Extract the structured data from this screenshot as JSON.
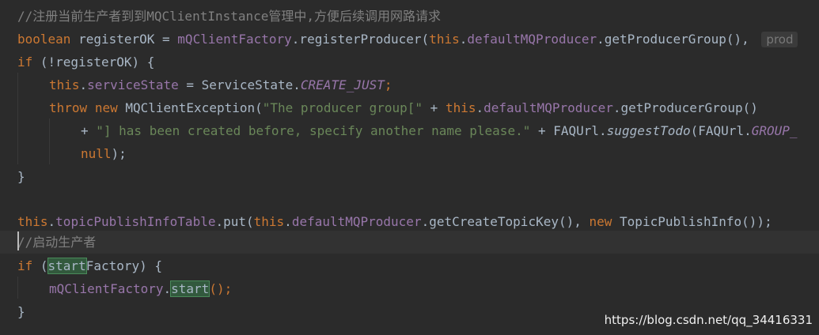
{
  "code": {
    "l1_comment": "//注册当前生产者到到MQClientInstance管理中,方便后续调用网路请求",
    "l2_kw": "boolean",
    "l2_var": " registerOK = ",
    "l2_fld": "mQClientFactory",
    "l2_call": ".registerProducer(",
    "l2_this": "this",
    "l2_dot": ".",
    "l2_fld2": "defaultMQProducer",
    "l2_tail": ".getProducerGroup(), ",
    "l2_hint": "prod",
    "l3_kw": "if",
    "l3_rest": " (!registerOK) {",
    "l4_this": "this",
    "l4_dot": ".",
    "l4_fld": "serviceState",
    "l4_mid": " = ServiceState.",
    "l4_const": "CREATE_JUST",
    "l4_semi": ";",
    "l5_kw1": "throw",
    "l5_kw2": "new",
    "l5_cls": " MQClientException(",
    "l5_str": "\"The producer group[\"",
    "l5_plus": " + ",
    "l5_this": "this",
    "l5_dot": ".",
    "l5_fld": "defaultMQProducer",
    "l5_tail": ".getProducerGroup()",
    "l6_plus": "+ ",
    "l6_str": "\"] has been created before, specify another name please.\"",
    "l6_mid": " + FAQUrl.",
    "l6_method": "suggestTodo",
    "l6_mid2": "(FAQUrl.",
    "l6_const": "GROUP_",
    "l7_kw": "null",
    "l7_rest": ");",
    "l8": "}",
    "l10_this": "this",
    "l10_dot": ".",
    "l10_fld": "topicPublishInfoTable",
    "l10_mid": ".put(",
    "l10_this2": "this",
    "l10_dot2": ".",
    "l10_fld2": "defaultMQProducer",
    "l10_mid2": ".getCreateTopicKey(), ",
    "l10_kw": "new",
    "l10_tail": " TopicPublishInfo());",
    "l11_comment": "//启动生产者",
    "l12_kw": "if",
    "l12_open": " (",
    "l12_hl": "start",
    "l12_rest": "Factory) {",
    "l13_fld": "mQClientFactory",
    "l13_dot": ".",
    "l13_hl": "start",
    "l13_rest": "();",
    "l14": "}"
  },
  "watermark": "https://blog.csdn.net/qq_34416331"
}
